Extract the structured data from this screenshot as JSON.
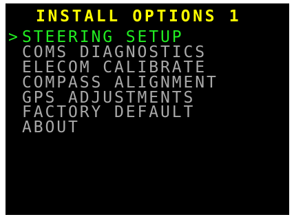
{
  "screen": {
    "title": "INSTALL OPTIONS 1"
  },
  "menu": {
    "cursor_glyph": ">",
    "selected_index": 0,
    "items": [
      {
        "label": "STEERING SETUP"
      },
      {
        "label": "COMS DIAGNOSTICS"
      },
      {
        "label": "ELECOM CALIBRATE"
      },
      {
        "label": "COMPASS ALIGNMENT"
      },
      {
        "label": "GPS ADJUSTMENTS"
      },
      {
        "label": "FACTORY DEFAULT"
      },
      {
        "label": "ABOUT"
      }
    ]
  },
  "colors": {
    "title": "#ffff00",
    "selected": "#22ee22",
    "unselected": "#a9a9a9",
    "background": "#000000"
  }
}
